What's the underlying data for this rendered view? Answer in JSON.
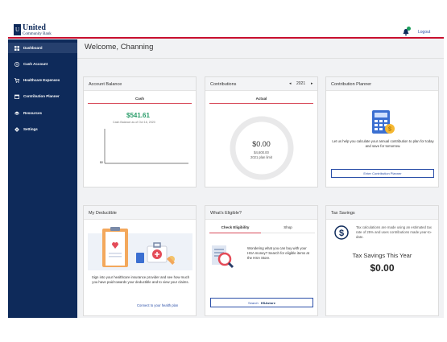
{
  "header": {
    "bank_name_main": "United",
    "bank_name_sub": "Community Bank",
    "logout": "Logout"
  },
  "sidebar": {
    "items": [
      {
        "label": "Dashboard",
        "icon": "dashboard-icon",
        "active": true
      },
      {
        "label": "Cash Account",
        "icon": "dollar-circle-icon"
      },
      {
        "label": "Healthcare Expenses",
        "icon": "cart-icon"
      },
      {
        "label": "Contribution Planner",
        "icon": "calendar-icon"
      },
      {
        "label": "Resources",
        "icon": "stack-icon"
      },
      {
        "label": "Settings",
        "icon": "gear-icon"
      }
    ]
  },
  "main": {
    "welcome": "Welcome, Channing"
  },
  "account_balance": {
    "title": "Account Balance",
    "tab": "Cash",
    "amount": "$541.61",
    "balance_note": "Cash Balance as of Oct 16, 2020",
    "axis_zero": "$0"
  },
  "contributions": {
    "title": "Contributions",
    "year": "2021",
    "tab": "Actual",
    "amount": "$0.00",
    "limit_amount": "$4,600.00",
    "limit_label": "2021 plan limit"
  },
  "planner": {
    "title": "Contribution Planner",
    "description": "Let us help you calculate your annual contribution to plan for today and save for tomorrow.",
    "button": "Enter Contribution Planner"
  },
  "deductible": {
    "title": "My Deductible",
    "description": "Sign into your healthcare insurance provider and see how much you have paid towards your deductible and to view your claims.",
    "link": "Connect to your health plan"
  },
  "eligible": {
    "title": "What's Eligible?",
    "tabs": [
      "Check Eligibility",
      "Shop"
    ],
    "description": "Wondering what you can buy with your HSA money? Search for eligible items at the HSA Store.",
    "search_label": "Search",
    "store_label": "HSAstore"
  },
  "tax": {
    "title": "Tax Savings",
    "description": "Tax calculations are made using an estimated tax rate of 25% and uses contributions made year-to-date.",
    "headline": "Tax Savings This Year",
    "amount": "$0.00"
  },
  "colors": {
    "navy": "#0e2a5a",
    "accent_red": "#c8102e",
    "green": "#2a9d6a",
    "link_blue": "#2b4fa8"
  }
}
